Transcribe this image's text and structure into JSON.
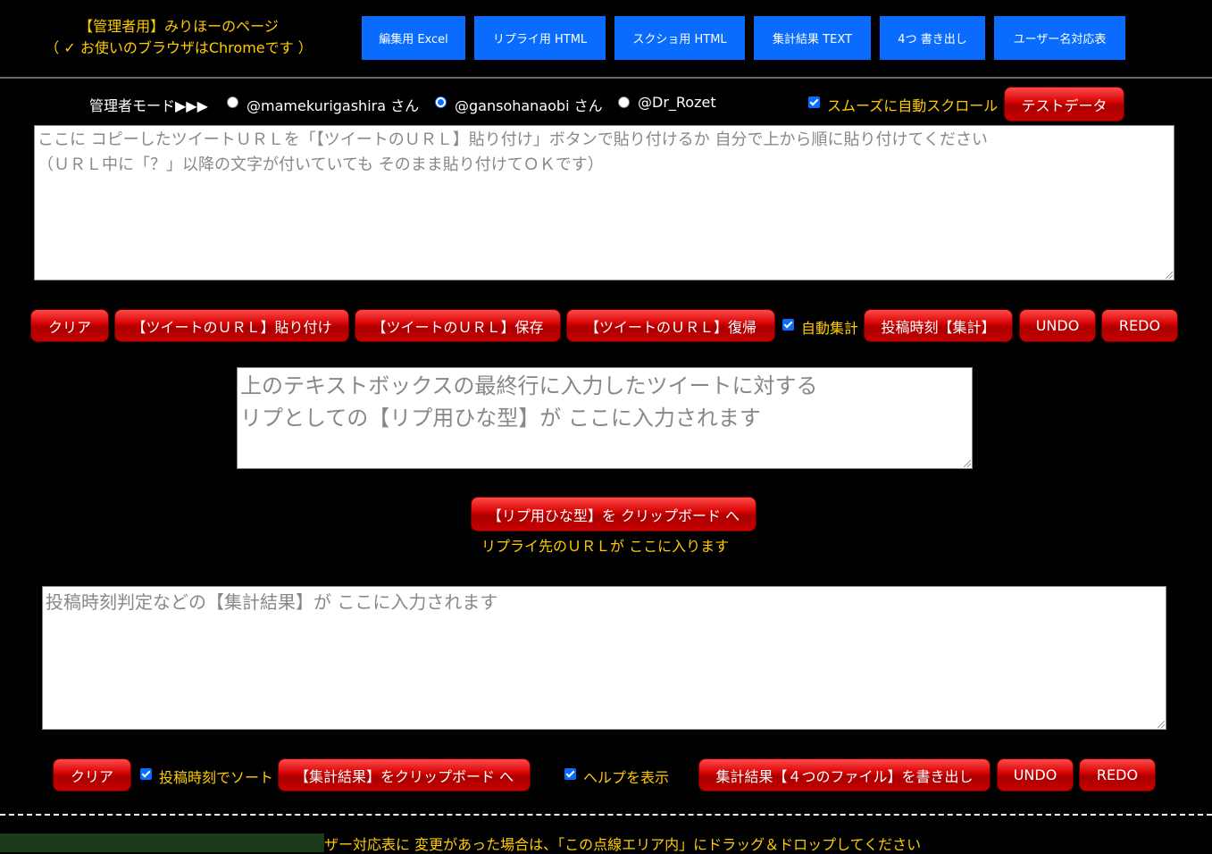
{
  "header": {
    "title_line1": "【管理者用】みりほーのページ",
    "title_line2": "（ ✓ お使いのブラウザはChromeです ）",
    "buttons": [
      "編集用 Excel",
      "リプライ用 HTML",
      "スクショ用 HTML",
      "集計結果 TEXT",
      "4つ 書き出し",
      "ユーザー名対応表"
    ]
  },
  "admin_mode": {
    "label": "管理者モード▶▶▶",
    "options": [
      "@mamekurigashira さん",
      "@gansohanaobi さん",
      "@Dr_Rozet"
    ],
    "selected_index": 1,
    "smooth_scroll_label": "スムーズに自動スクロール",
    "smooth_scroll_checked": true,
    "test_data_button": "テストデータ"
  },
  "url_box": {
    "placeholder": "ここに コピーしたツイートＵＲＬを「【ツイートのＵＲＬ】貼り付け」ボタンで貼り付けるか 自分で上から順に貼り付けてください\n（ＵＲＬ中に「？」以降の文字が付いていても そのまま貼り付けてＯＫです）"
  },
  "toolbar1": {
    "clear": "クリア",
    "paste": "【ツイートのＵＲＬ】貼り付け",
    "save": "【ツイートのＵＲＬ】保存",
    "restore": "【ツイートのＵＲＬ】復帰",
    "auto_tally_label": "自動集計",
    "auto_tally_checked": true,
    "tally": "投稿時刻【集計】",
    "undo": "UNDO",
    "redo": "REDO"
  },
  "reply_box": {
    "placeholder": "上のテキストボックスの最終行に入力したツイートに対する\nリプとしての【リプ用ひな型】が ここに入力されます"
  },
  "reply_copy": {
    "button": "【リプ用ひな型】を クリップボード へ",
    "note": "リプライ先のＵＲＬが ここに入ります"
  },
  "result_box": {
    "placeholder": "投稿時刻判定などの【集計結果】が ここに入力されます"
  },
  "toolbar2": {
    "clear": "クリア",
    "sort_label": "投稿時刻でソート",
    "sort_checked": true,
    "copy_result": "【集計結果】をクリップボード へ",
    "help_label": "ヘルプを表示",
    "help_checked": true,
    "export": "集計結果【４つのファイル】を書き出し",
    "undo": "UNDO",
    "redo": "REDO"
  },
  "drop_area": {
    "text": "ザー対応表に 変更があった場合は、「この点線エリア内」にドラッグ＆ドロップしてください"
  }
}
